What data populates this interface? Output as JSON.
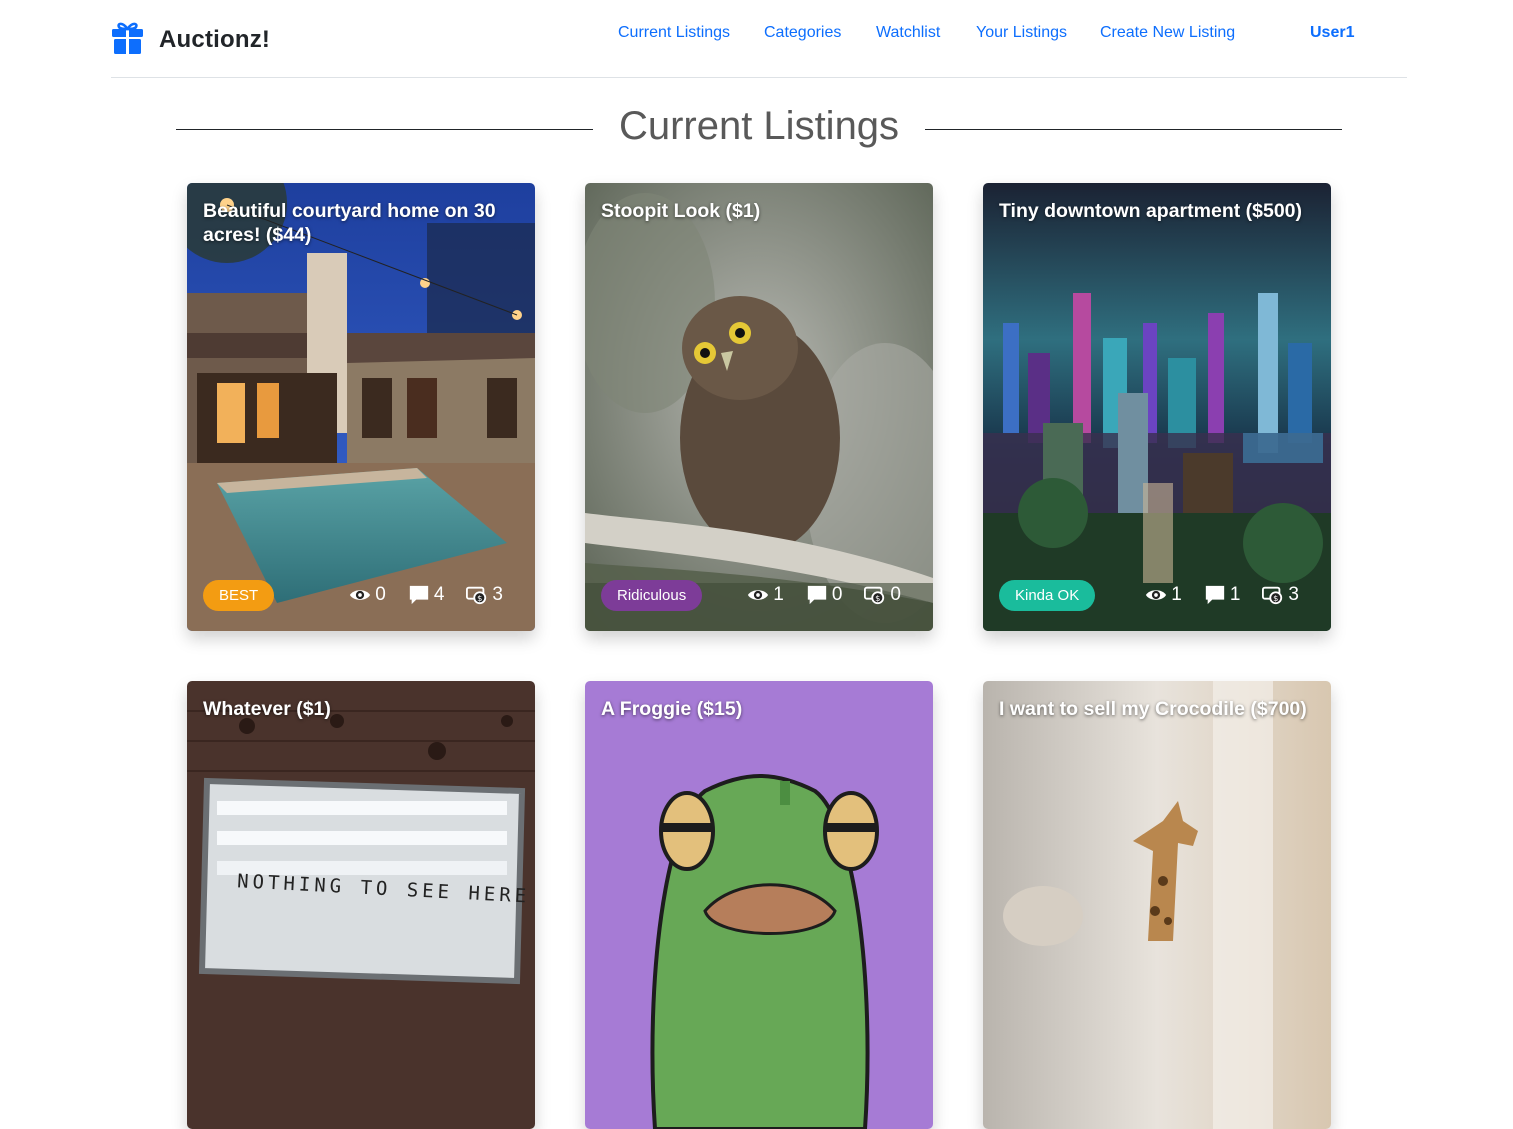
{
  "brand": {
    "name": "Auctionz!",
    "icon": "gift-icon",
    "accent": "#0d6efd"
  },
  "nav": [
    {
      "label": "Current Listings"
    },
    {
      "label": "Categories"
    },
    {
      "label": "Watchlist"
    },
    {
      "label": "Your Listings"
    },
    {
      "label": "Create New Listing"
    }
  ],
  "user": {
    "name": "User1"
  },
  "page_title": "Current Listings",
  "listings": [
    {
      "title": "Beautiful courtyard home on 30 acres! ($44)",
      "category": "BEST",
      "category_color": "#f39c12",
      "views": "0",
      "comments": "4",
      "bids": "3"
    },
    {
      "title": "Stoopit Look ($1)",
      "category": "Ridiculous",
      "category_color": "#7d3c98",
      "views": "1",
      "comments": "0",
      "bids": "0"
    },
    {
      "title": "Tiny downtown apartment ($500)",
      "category": "Kinda OK",
      "category_color": "#1abc9c",
      "views": "1",
      "comments": "1",
      "bids": "3"
    },
    {
      "title": "Whatever ($1)",
      "sign_text": "NOTHING TO SEE HERE"
    },
    {
      "title": "A Froggie ($15)"
    },
    {
      "title": "I want to sell my Crocodile ($700)"
    }
  ]
}
